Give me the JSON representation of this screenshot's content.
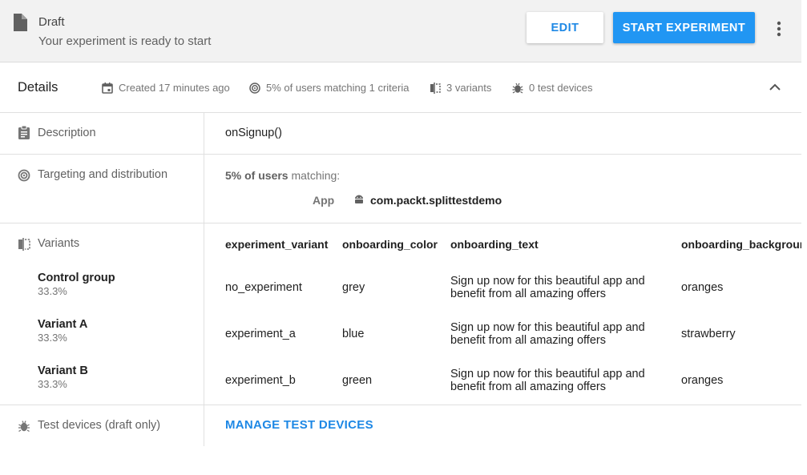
{
  "header": {
    "title": "Draft",
    "subtitle": "Your experiment is ready to start",
    "edit_label": "EDIT",
    "start_label": "START EXPERIMENT"
  },
  "details": {
    "title": "Details",
    "created": "Created 17 minutes ago",
    "users_matching": "5% of users matching 1 criteria",
    "variants_count": "3 variants",
    "test_devices": "0 test devices"
  },
  "description": {
    "label": "Description",
    "value": "onSignup()"
  },
  "targeting": {
    "label": "Targeting and distribution",
    "users_pct": "5% of users",
    "matching": "matching:",
    "app_label": "App",
    "app_value": "com.packt.splittestdemo"
  },
  "variants": {
    "label": "Variants",
    "columns": [
      "experiment_variant",
      "onboarding_color",
      "onboarding_text",
      "onboarding_background"
    ],
    "rows": [
      {
        "name": "Control group",
        "pct": "33.3%",
        "cells": [
          "no_experiment",
          "grey",
          "Sign up now for this beautiful app and benefit from all amazing offers",
          "oranges"
        ]
      },
      {
        "name": "Variant A",
        "pct": "33.3%",
        "cells": [
          "experiment_a",
          "blue",
          "Sign up now for this beautiful app and benefit from all amazing offers",
          "strawberry"
        ]
      },
      {
        "name": "Variant B",
        "pct": "33.3%",
        "cells": [
          "experiment_b",
          "green",
          "Sign up now for this beautiful app and benefit from all amazing offers",
          "oranges"
        ]
      }
    ]
  },
  "test_devices_row": {
    "label": "Test devices (draft only)",
    "link": "MANAGE TEST DEVICES"
  },
  "colors": {
    "accent": "#2196f3",
    "link": "#1e88e5",
    "header_bg": "#f2f2f2"
  },
  "icons": [
    "file-icon",
    "more-vert-icon",
    "calendar-icon",
    "target-icon",
    "compare-icon",
    "bug-icon",
    "chevron-up-icon",
    "clipboard-icon",
    "android-icon"
  ]
}
